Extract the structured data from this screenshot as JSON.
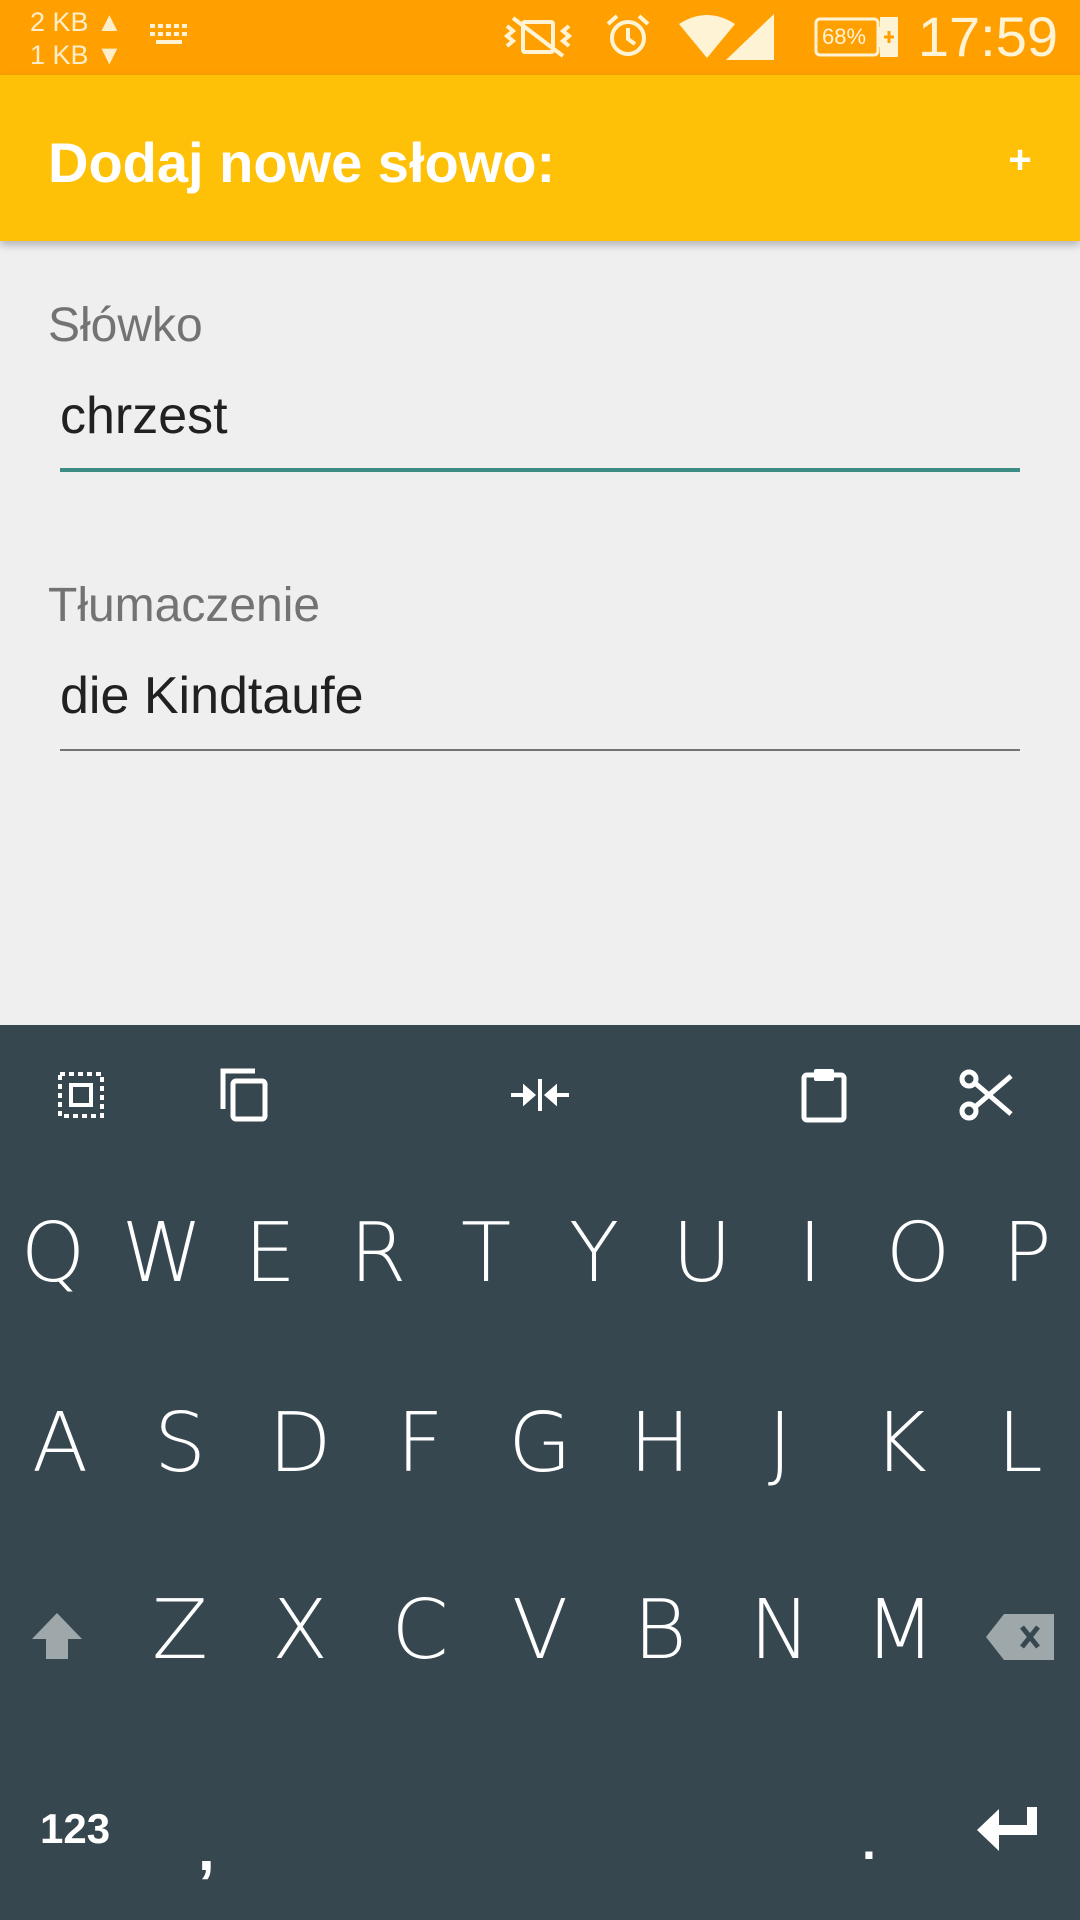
{
  "status_bar": {
    "upload": "2 KB ▲",
    "download": "1 KB ▼",
    "battery": "68%",
    "time": "17:59"
  },
  "app_bar": {
    "title": "Dodaj nowe słowo:",
    "action": "+"
  },
  "form": {
    "word_label": "Słówko",
    "word_value": "chrzest",
    "translation_label": "Tłumaczenie",
    "translation_value": "die Kindtaufe"
  },
  "keyboard": {
    "row1": [
      "Q",
      "W",
      "E",
      "R",
      "T",
      "Y",
      "U",
      "I",
      "O",
      "P"
    ],
    "row2": [
      "A",
      "S",
      "D",
      "F",
      "G",
      "H",
      "J",
      "K",
      "L"
    ],
    "row3": [
      "Z",
      "X",
      "C",
      "V",
      "B",
      "N",
      "M"
    ],
    "numbers_label": "123",
    "comma": ",",
    "period": "."
  },
  "colors": {
    "status_bar": "#ffa000",
    "app_bar": "#ffc107",
    "accent": "#3d8b85",
    "keyboard_bg": "#37474f"
  }
}
